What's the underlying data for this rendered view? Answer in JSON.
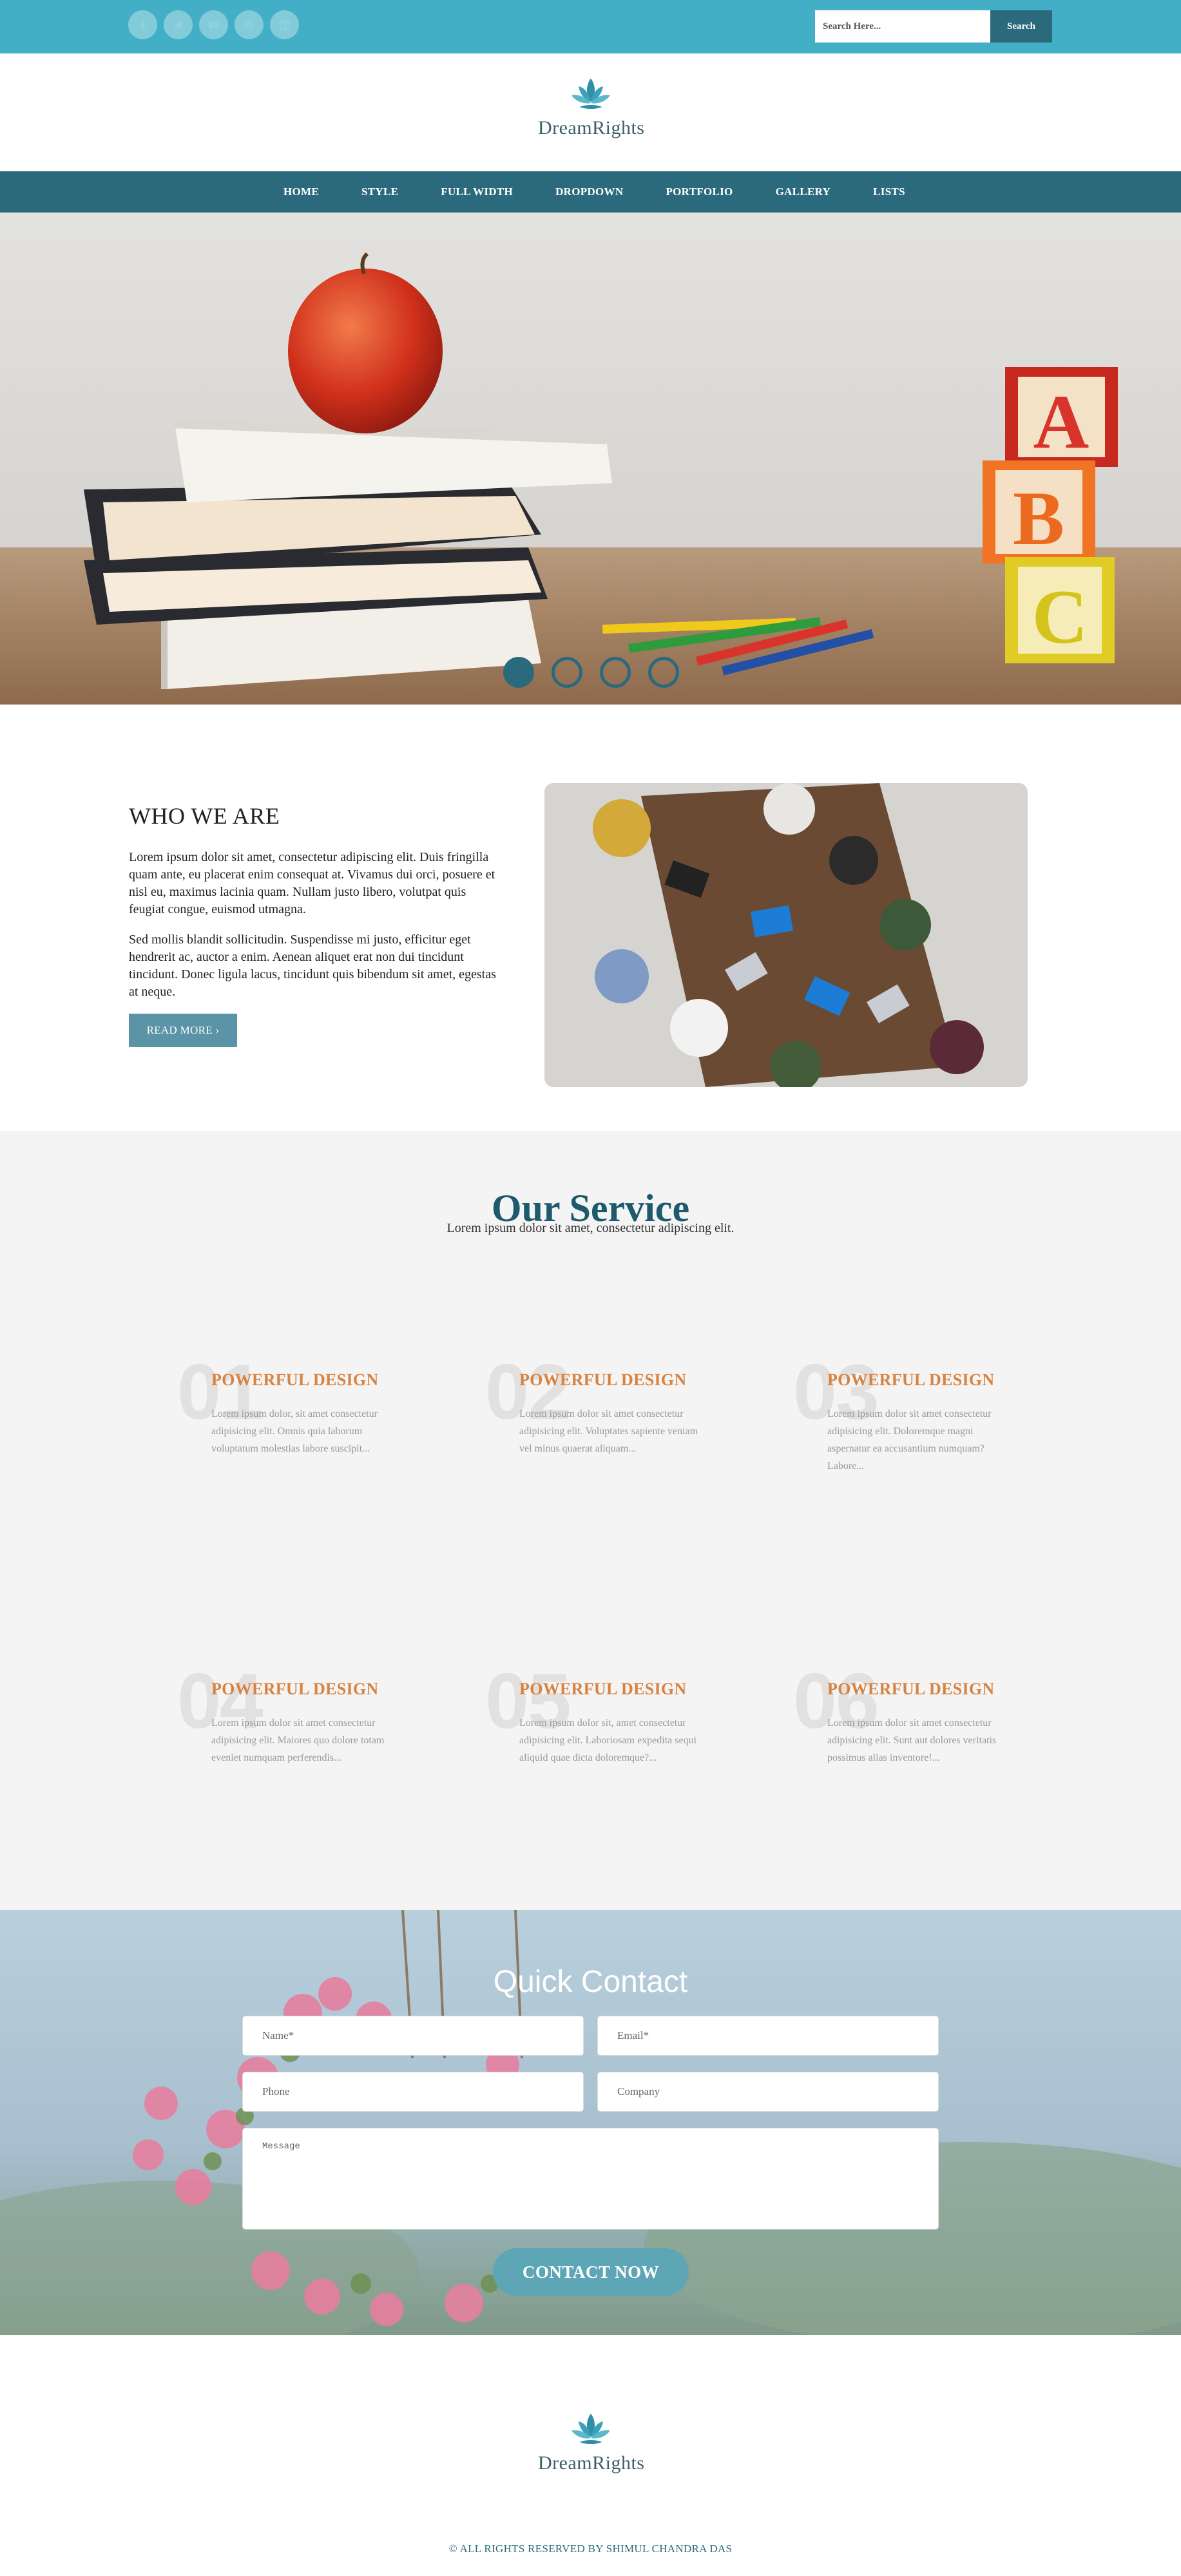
{
  "topbar": {
    "social_icons": [
      "facebook-icon",
      "twitter-icon",
      "youtube-icon",
      "pinterest-icon",
      "linkedin-icon"
    ],
    "search_placeholder": "Search Here...",
    "search_button": "Search"
  },
  "brand": {
    "logo_text": "DreamRights"
  },
  "nav": {
    "items": [
      "HOME",
      "STYLE",
      "FULL WIDTH",
      "DROPDOWN",
      "PORTFOLIO",
      "GALLERY",
      "LISTS"
    ]
  },
  "hero": {
    "slide_count": 4,
    "active_slide": 1
  },
  "about": {
    "title": "WHO WE ARE",
    "paragraphs": [
      "Lorem ipsum dolor sit amet, consectetur adipiscing elit. Duis fringilla quam ante, eu placerat enim consequat at. Vivamus dui orci, posuere et nisl eu, maximus lacinia quam. Nullam justo libero, volutpat quis feugiat congue, euismod utmagna.",
      "Sed mollis blandit sollicitudin. Suspendisse mi justo, efficitur eget hendrerit ac, auctor a enim. Aenean aliquet erat non dui tincidunt tincidunt. Donec ligula lacus, tincidunt quis bibendum sit amet, egestas at neque."
    ],
    "button": "READ MORE ›"
  },
  "services": {
    "title": "Our Service",
    "subtitle": "Lorem ipsum dolor sit amet, consectetur adipiscing elit.",
    "items": [
      {
        "number": "01",
        "name": "POWERFUL DESIGN",
        "description": "Lorem ipsum dolor, sit amet consectetur adipisicing elit. Omnis quia laborum voluptatum molestias labore suscipit..."
      },
      {
        "number": "02",
        "name": "POWERFUL DESIGN",
        "description": "Lorem ipsum dolor sit amet consectetur adipisicing elit. Voluptates sapiente veniam vel minus quaerat aliquam..."
      },
      {
        "number": "03",
        "name": "POWERFUL DESIGN",
        "description": "Lorem ipsum dolor sit amet consectetur adipisicing elit. Doloremque magni aspernatur ea accusantium numquam? Labore..."
      },
      {
        "number": "04",
        "name": "POWERFUL DESIGN",
        "description": "Lorem ipsum dolor sit amet consectetur adipisicing elit. Maiores quo dolore totam eveniet numquam perferendis..."
      },
      {
        "number": "05",
        "name": "POWERFUL DESIGN",
        "description": "Lorem ipsum dolor sit, amet consectetur adipisicing elit. Laboriosam expedita sequi aliquid quae dicta doloremque?..."
      },
      {
        "number": "06",
        "name": "POWERFUL DESIGN",
        "description": "Lorem ipsum dolor sit amet consectetur adipisicing elit. Sunt aut dolores veritatis possimus alias inventore!..."
      }
    ]
  },
  "contact": {
    "title": "Quick Contact",
    "name_placeholder": "Name*",
    "email_placeholder": "Email*",
    "phone_placeholder": "Phone",
    "company_placeholder": "Company",
    "message_placeholder": "Message",
    "button": "CONTACT NOW"
  },
  "footer": {
    "copyright": "© ALL RIGHTS RESERVED BY SHIMUL CHANDRA DAS"
  },
  "colors": {
    "topbar": "#43afc7",
    "nav": "#2b6a7c",
    "accent_orange": "#d8823f",
    "service_title": "#1e5a6d",
    "contact_button": "#5da6b6"
  }
}
